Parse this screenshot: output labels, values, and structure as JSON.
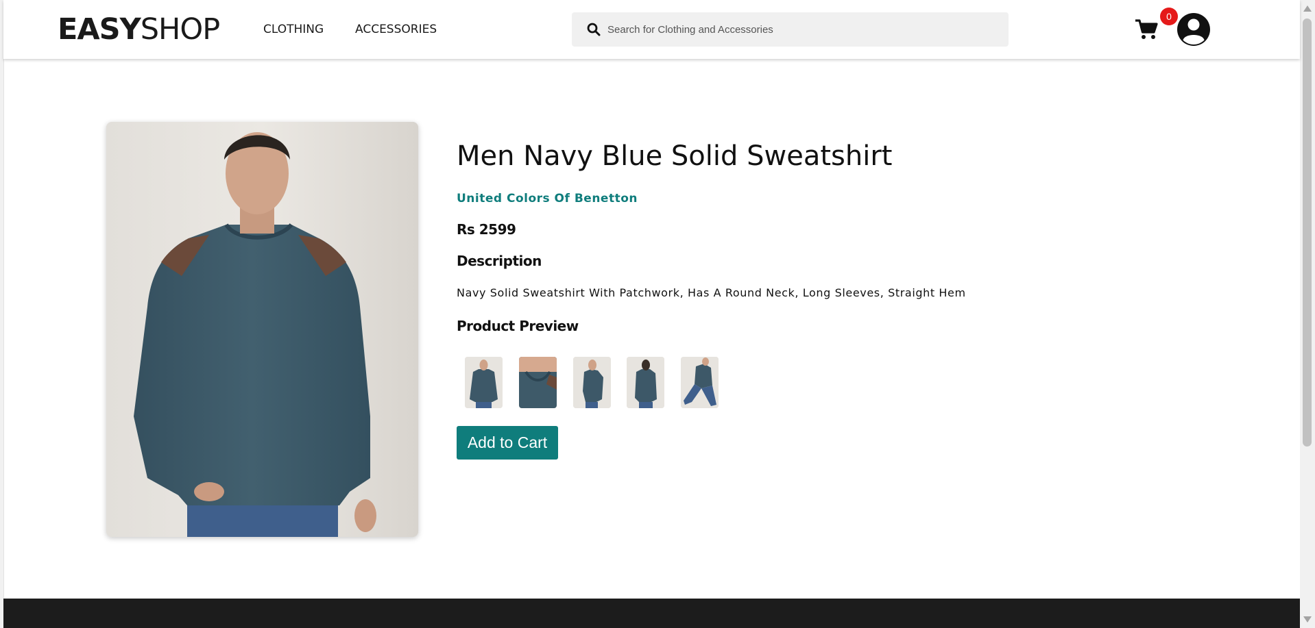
{
  "header": {
    "logo": {
      "bold": "EASY",
      "light": "SHOP"
    },
    "nav": [
      {
        "label": "CLOTHING"
      },
      {
        "label": "ACCESSORIES"
      }
    ],
    "search": {
      "placeholder": "Search for Clothing and Accessories",
      "value": ""
    },
    "cart": {
      "count": "0",
      "icon": "cart-icon"
    },
    "user": {
      "icon": "user-avatar-icon"
    }
  },
  "product": {
    "title": "Men Navy Blue Solid Sweatshirt",
    "brand": "United Colors Of Benetton",
    "price": "Rs 2599",
    "description_heading": "Description",
    "description": "Navy Solid Sweatshirt With Patchwork, Has A Round Neck, Long Sleeves, Straight Hem",
    "preview_heading": "Product Preview",
    "preview_thumbnails": [
      "front-view",
      "neck-closeup",
      "side-view",
      "back-view",
      "seated-view"
    ],
    "add_to_cart_label": "Add to Cart"
  },
  "colors": {
    "accent": "#0f7d7c",
    "badge": "#e51a1a",
    "footer": "#1c1c1c",
    "sweatshirt": "#3d5868"
  }
}
